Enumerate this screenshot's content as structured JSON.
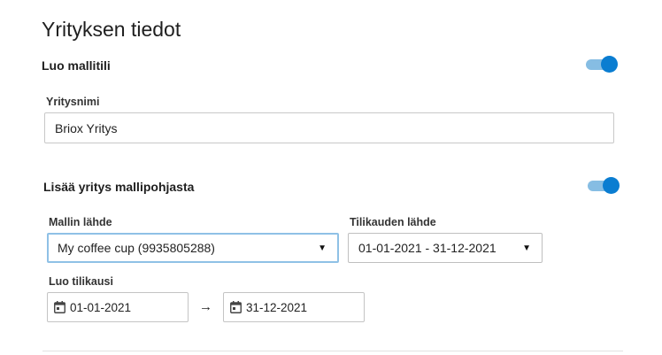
{
  "page": {
    "title": "Yrityksen tiedot"
  },
  "template_account": {
    "label": "Luo mallitili",
    "toggle_on": true
  },
  "company_name": {
    "label": "Yritysnimi",
    "value": "Briox Yritys"
  },
  "add_from_template": {
    "label": "Lisää yritys mallipohjasta",
    "toggle_on": true
  },
  "template_source": {
    "label": "Mallin lähde",
    "selected": "My coffee cup (9935805288)"
  },
  "fiscal_source": {
    "label": "Tilikauden lähde",
    "selected": "01-01-2021 - 31-12-2021"
  },
  "create_fiscal_year": {
    "label": "Luo tilikausi",
    "start_date": "01-01-2021",
    "end_date": "31-12-2021",
    "separator": "→"
  },
  "icons": {
    "toggle_color": "#0a7dd1",
    "toggle_track_color": "#86bde3",
    "dropdown": "chevron-down-icon",
    "date": "calendar-icon"
  }
}
